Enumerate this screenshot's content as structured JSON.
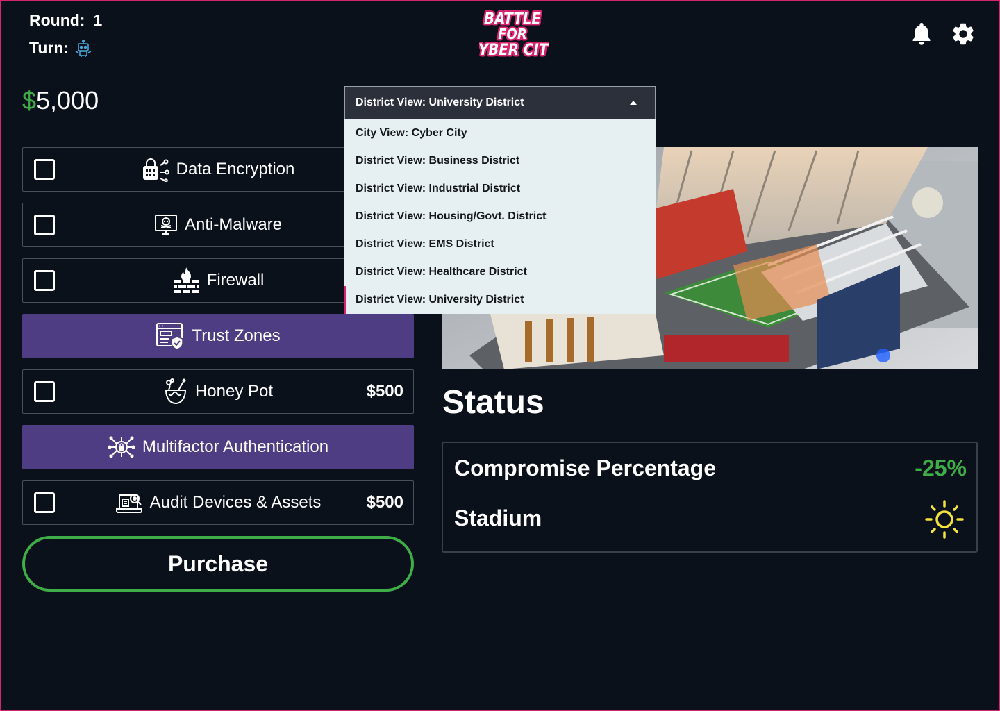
{
  "header": {
    "round_label": "Round:",
    "round_value": "1",
    "turn_label": "Turn:",
    "turn_icon": "robot-icon",
    "logo_lines": [
      "BATTLE",
      "FOR",
      "CYBER CITY"
    ],
    "logo_color": "#d6246e"
  },
  "budget": {
    "currency": "$",
    "amount": "5,000",
    "currency_color": "#3fae49"
  },
  "defenses": [
    {
      "label": "Data Encryption",
      "icon": "lock-icon",
      "selected": false,
      "price": ""
    },
    {
      "label": "Anti-Malware",
      "icon": "monitor-skull-icon",
      "selected": false,
      "price": ""
    },
    {
      "label": "Firewall",
      "icon": "firewall-icon",
      "selected": false,
      "price": ""
    },
    {
      "label": "Trust Zones",
      "icon": "shield-window-icon",
      "selected": true,
      "price": ""
    },
    {
      "label": "Honey Pot",
      "icon": "honey-pot-icon",
      "selected": false,
      "price": "$500"
    },
    {
      "label": "Multifactor Authentication",
      "icon": "network-lock-icon",
      "selected": true,
      "price": ""
    },
    {
      "label": "Audit Devices & Assets",
      "icon": "audit-icon",
      "selected": false,
      "price": "$500"
    }
  ],
  "purchase_label": "Purchase",
  "view_dropdown": {
    "selected": "District View: University  District",
    "options": [
      "City View: Cyber City",
      "District View: Business District",
      "District View: Industrial District",
      "District View: Housing/Govt.  District",
      "District View: EMS  District",
      "District View: Healthcare  District",
      "District View: University  District"
    ],
    "active_index": 6
  },
  "status": {
    "title": "Status",
    "compromise_label": "Compromise Percentage",
    "compromise_value": "-25%",
    "location_label": "Stadium",
    "location_icon": "sun-icon",
    "value_color": "#3fae49",
    "sun_color": "#f3e33a"
  },
  "colors": {
    "background": "#0b111b",
    "selected_option": "#4e3d83",
    "accent": "#d6246e",
    "purchase_border": "#3fae49"
  }
}
